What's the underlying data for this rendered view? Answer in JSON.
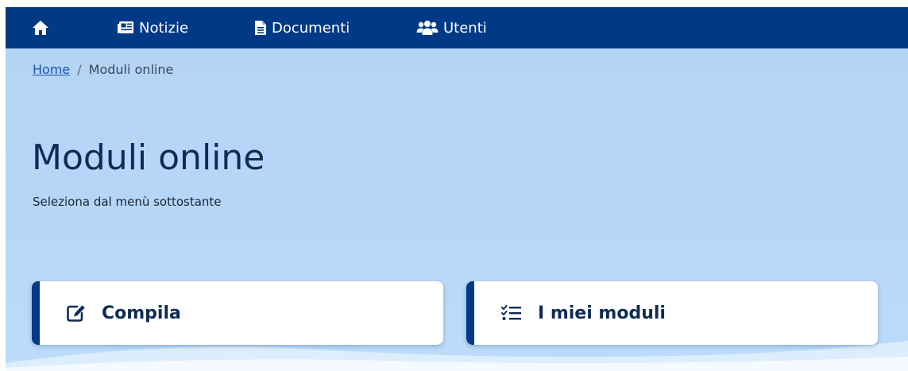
{
  "nav": {
    "home_icon": "home-icon",
    "items": [
      {
        "label": "Notizie",
        "icon": "newspaper-icon"
      },
      {
        "label": "Documenti",
        "icon": "document-icon"
      },
      {
        "label": "Utenti",
        "icon": "users-icon"
      }
    ]
  },
  "breadcrumb": {
    "home": "Home",
    "separator": "/",
    "current": "Moduli online"
  },
  "page": {
    "title": "Moduli online",
    "subtitle": "Seleziona dal menù sottostante"
  },
  "cards": [
    {
      "label": "Compila",
      "icon": "edit-icon"
    },
    {
      "label": "I miei moduli",
      "icon": "checklist-icon"
    }
  ],
  "colors": {
    "nav_background": "#003985",
    "page_background": "#b6d6f8",
    "accent": "#003985",
    "title_text": "#0e2c55",
    "link": "#1a56b0"
  }
}
